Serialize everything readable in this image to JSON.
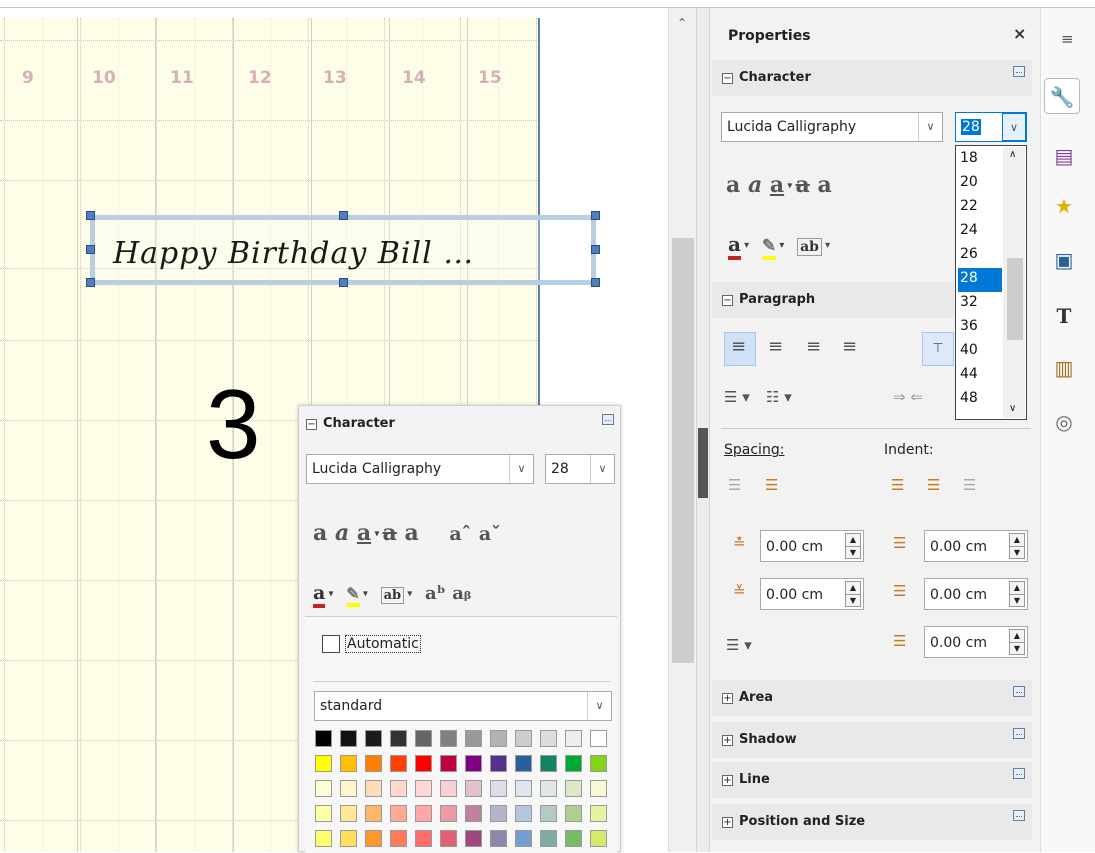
{
  "slide": {
    "day_numbers": [
      "9",
      "10",
      "11",
      "12",
      "13",
      "14",
      "15"
    ],
    "textbox_text": "Happy Birthday Bill …",
    "big_number": "3"
  },
  "sidebar": {
    "title": "Properties",
    "close_label": "×",
    "character": {
      "heading": "Character",
      "font_name": "Lucida Calligraphy",
      "font_size": "28",
      "size_options": [
        "18",
        "20",
        "22",
        "24",
        "26",
        "28",
        "32",
        "36",
        "40",
        "44",
        "48"
      ],
      "selected_size": "28"
    },
    "paragraph": {
      "heading": "Paragraph",
      "spacing_label": "Spacing:",
      "indent_label": "Indent:",
      "above_spacing": "0.00 cm",
      "below_spacing": "0.00 cm",
      "before_indent": "0.00 cm",
      "after_indent": "0.00 cm",
      "first_line_indent": "0.00 cm"
    },
    "sections": [
      "Area",
      "Shadow",
      "Line",
      "Position and Size"
    ]
  },
  "popup": {
    "heading": "Character",
    "font_name": "Lucida Calligraphy",
    "font_size": "28",
    "automatic_label": "Automatic",
    "palette_name": "standard",
    "swatch_rows": [
      [
        "#000000",
        "#111111",
        "#1c1c1c",
        "#333333",
        "#666666",
        "#808080",
        "#999999",
        "#b2b2b2",
        "#cccccc",
        "#dddddd",
        "#eeeeee",
        "#ffffff"
      ],
      [
        "#ffff00",
        "#ffbf00",
        "#ff8000",
        "#ff4000",
        "#ff0000",
        "#bf0041",
        "#800080",
        "#55308d",
        "#2a6099",
        "#158466",
        "#00a933",
        "#81d41a"
      ],
      [
        "#ffffd7",
        "#fff5ce",
        "#ffdbb6",
        "#ffd8ce",
        "#ffd7d7",
        "#f7d1d5",
        "#e0c2cd",
        "#dedce6",
        "#dee6ef",
        "#dee7e5",
        "#dde8cb",
        "#f6f9d4"
      ],
      [
        "#ffffa6",
        "#ffe994",
        "#ffb66c",
        "#ffaa95",
        "#ffa6a6",
        "#ec9ba4",
        "#bf819e",
        "#b7b3ca",
        "#b4c7dc",
        "#b3cac7",
        "#afd095",
        "#e8f2a1"
      ],
      [
        "#ffff6d",
        "#ffde59",
        "#ff972f",
        "#ff7b59",
        "#ff6d6d",
        "#e16173",
        "#a1467e",
        "#8e86ae",
        "#729fcf",
        "#81aca6",
        "#77bc65",
        "#d4ea6b"
      ]
    ]
  },
  "colors": {
    "accent": "#0078d7",
    "slide_bg": "#fdfde8",
    "day_number": "#d5b0b8"
  }
}
